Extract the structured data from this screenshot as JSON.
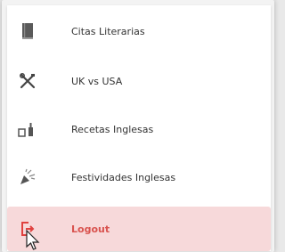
{
  "menu": {
    "items": [
      {
        "label": "Citas Literarias",
        "icon": "book-icon"
      },
      {
        "label": "UK vs USA",
        "icon": "crossed-tools-icon"
      },
      {
        "label": "Recetas Inglesas",
        "icon": "kitchen-icon"
      },
      {
        "label": "Festividades Inglesas",
        "icon": "party-popper-icon"
      },
      {
        "label": "Logout",
        "icon": "logout-icon"
      }
    ]
  },
  "colors": {
    "icon": "#555555",
    "logout_accent": "#e0413f",
    "logout_bg": "#f7d9da"
  }
}
